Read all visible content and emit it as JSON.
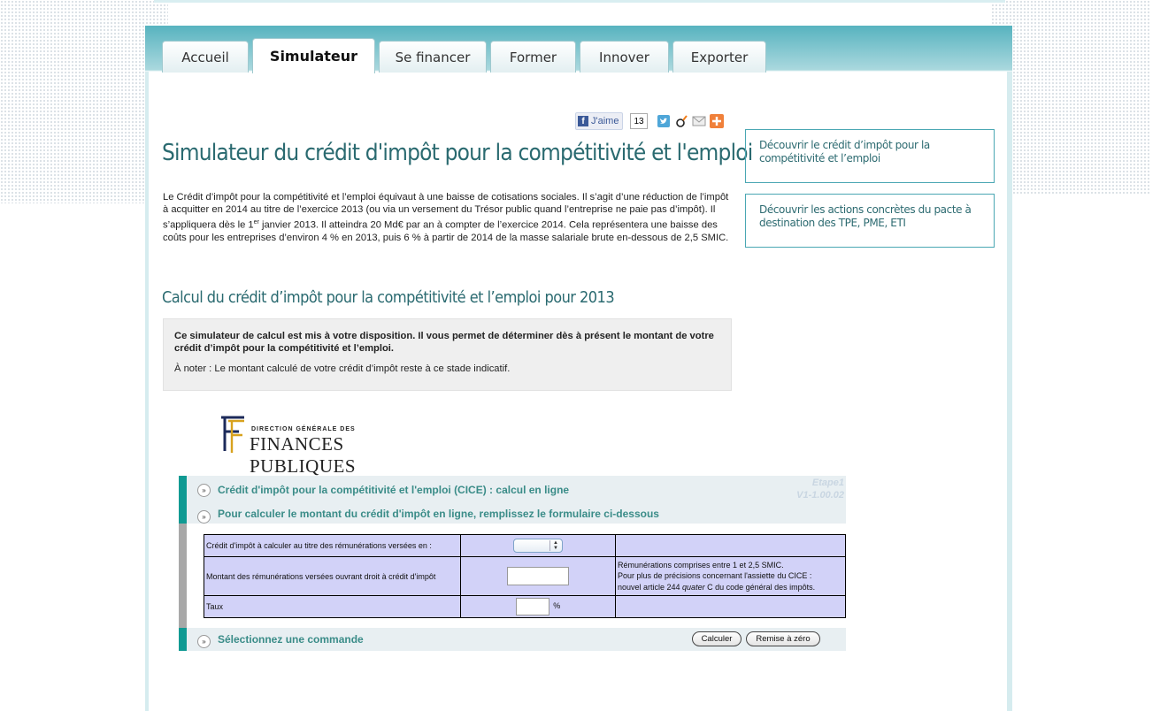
{
  "nav": {
    "tabs": [
      {
        "label": "Accueil"
      },
      {
        "label": "Simulateur"
      },
      {
        "label": "Se financer"
      },
      {
        "label": "Former"
      },
      {
        "label": "Innover"
      },
      {
        "label": "Exporter"
      }
    ],
    "active_tab": "Simulateur"
  },
  "social": {
    "like_label": "J'aime",
    "like_count": "13"
  },
  "main": {
    "title": "Simulateur du crédit d'impôt pour la compétitivité et l'emploi",
    "intro_before_sup": "Le Crédit d’impôt pour la compétitivité et l’emploi équivaut à une baisse de cotisations sociales. Il s’agit d’une réduction de l’impôt à acquitter en 2014 au titre de l’exercice 2013 (ou via un versement du Trésor public quand l’entreprise ne paie pas d’impôt). Il s’appliquera dès le 1",
    "intro_sup": "er",
    "intro_after_sup": " janvier 2013. Il atteindra 20 Md€ par an à compter de l’exercice 2014. Cela représentera une baisse des coûts pour les entreprises d’environ 4 % en 2013, puis 6 % à partir de 2014 de la masse salariale brute en-dessous de 2,5 SMIC.",
    "subtitle": "Calcul du crédit d’impôt pour la compétitivité et l’emploi pour 2013",
    "infobox_bold": "Ce simulateur de calcul est mis à votre disposition. Il vous permet de déterminer dès à présent le montant de votre crédit d’impôt pour la compétitivité et l’emploi.",
    "infobox_note": "À noter : Le montant calculé de votre crédit d’impôt reste à ce stade indicatif."
  },
  "sidebar": {
    "links": [
      {
        "label": "Découvrir le crédit d’impôt pour la compétitivité et l’emploi"
      },
      {
        "label": "Découvrir les actions concrètes du pacte à destination des TPE, PME, ETI"
      }
    ]
  },
  "logo": {
    "line1": "DIRECTION GÉNÉRALE DES",
    "line2": "FINANCES PUBLIQUES"
  },
  "widget": {
    "heading": "Crédit d'impôt pour la compétitivité et l'emploi (CICE) : calcul en ligne",
    "instruction": "Pour calculer le montant du crédit d'impôt en ligne, remplissez le formulaire ci-dessous",
    "etape": "Etape1",
    "version": "V1-1.00.02",
    "rows": [
      {
        "label": "Crédit d'impôt à calculer au titre des rémunérations versées en :",
        "value": "",
        "help": ""
      },
      {
        "label": "Montant des rémunérations versées ouvrant droit à crédit d'impôt",
        "value": "",
        "help_line1": "Rémunérations comprises entre 1 et 2,5 SMIC.",
        "help_line2": "Pour plus de précisions concernant l'assiette du CICE :",
        "help_line3_a": "nouvel article 244 ",
        "help_line3_b": "quater",
        "help_line3_c": " C du code général des impôts."
      },
      {
        "label": "Taux",
        "value": "",
        "unit": "%"
      }
    ],
    "command_label": "Sélectionnez une commande",
    "btn_calculate": "Calculer",
    "btn_reset": "Remise à zéro"
  }
}
